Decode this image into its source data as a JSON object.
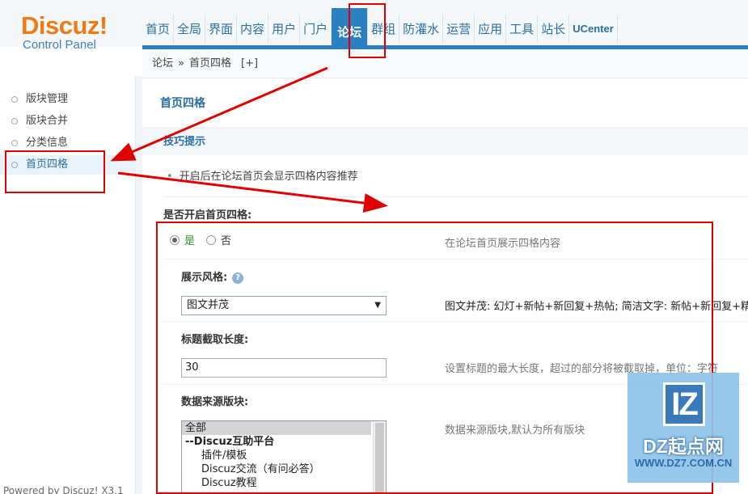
{
  "logo": {
    "brand": "Discuz!",
    "sub": "Control Panel"
  },
  "nav": [
    "首页",
    "全局",
    "界面",
    "内容",
    "用户",
    "门户",
    "论坛",
    "群组",
    "防灌水",
    "运营",
    "应用",
    "工具",
    "站长",
    "UCenter"
  ],
  "breadcrumb": {
    "root": "论坛",
    "sep": "»",
    "current": "首页四格",
    "add": "[+]"
  },
  "sidebar": {
    "items": [
      {
        "label": "版块管理"
      },
      {
        "label": "版块合并"
      },
      {
        "label": "分类信息"
      },
      {
        "label": "首页四格"
      }
    ],
    "powered": "Powered by Discuz! X3.1"
  },
  "main": {
    "title": "首页四格",
    "tips_title": "技巧提示",
    "tip": "开启后在论坛首页会显示四格内容推荐",
    "enable": {
      "label": "是否开启首页四格:",
      "yes": "是",
      "no": "否",
      "hint": "在论坛首页展示四格内容"
    },
    "style": {
      "label": "展示风格:",
      "help": "?",
      "value": "图文并茂",
      "hint": "图文并茂: 幻灯+新帖+新回复+热帖; 简洁文字: 新帖+新回复+精华"
    },
    "title_length": {
      "label": "标题截取长度:",
      "value": "30",
      "hint": "设置标题的最大长度，超过的部分将被截取掉，单位：字符"
    },
    "source": {
      "label": "数据来源版块:",
      "options": [
        "全部",
        "--Discuz互助平台",
        "插件/模板",
        "Discuz交流（有问必答）",
        "Discuz教程"
      ],
      "hint": "数据来源版块,默认为所有版块"
    }
  },
  "watermark": {
    "badge": "IZ",
    "line1": "DZ起点网",
    "line2": "WWW.DZ7.COM.CN"
  },
  "colors": {
    "accent": "#2b80c2",
    "brand_orange": "#f07b15",
    "annotation_red": "#e00000"
  }
}
